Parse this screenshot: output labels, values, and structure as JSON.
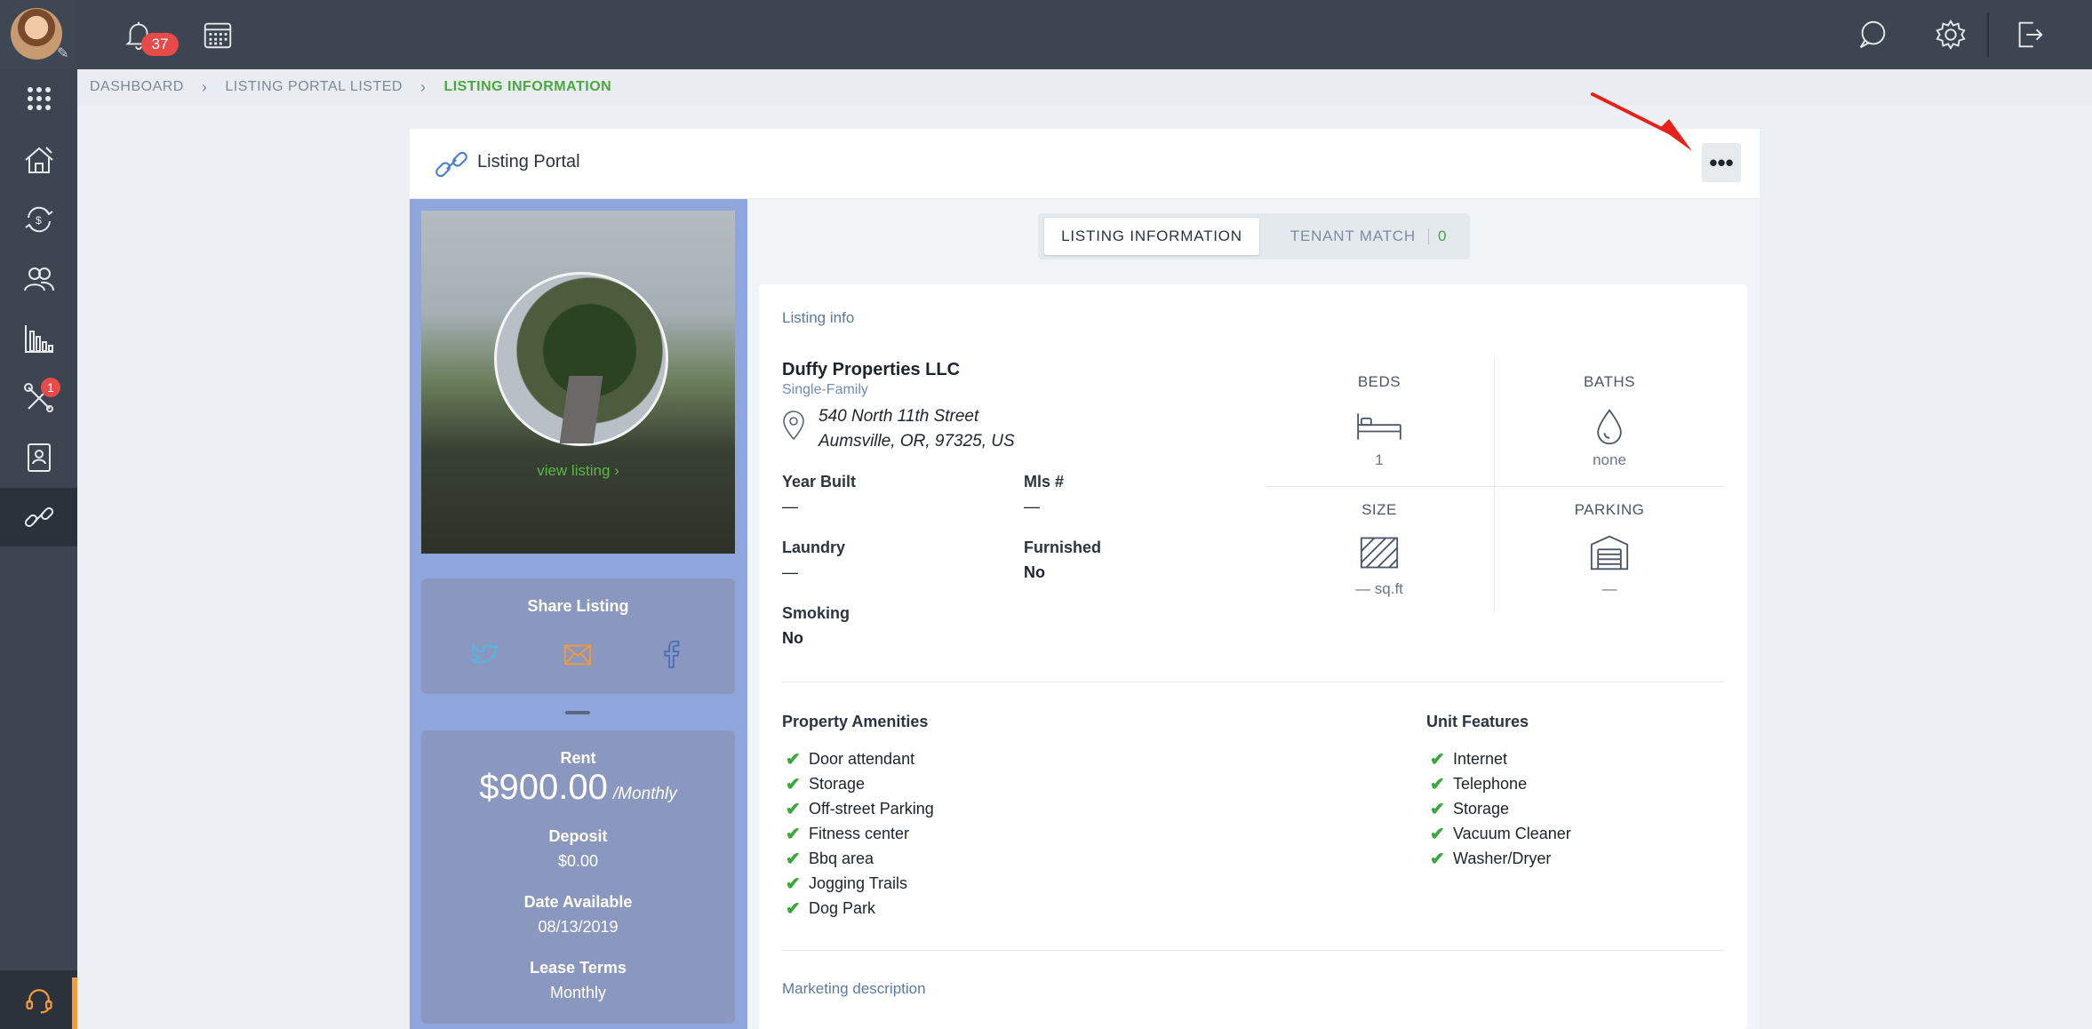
{
  "colors": {
    "sidebar": "#3d4551",
    "accent_green": "#4aa83c",
    "badge_red": "#e84a4a",
    "panel_blue": "#8ea6dc",
    "annotation_arrow": "#e8201a"
  },
  "topbar": {
    "notifications_count": "37"
  },
  "sidebar": {
    "items": [
      {
        "icon": "apps-grid-icon"
      },
      {
        "icon": "properties-icon"
      },
      {
        "icon": "transactions-icon"
      },
      {
        "icon": "people-icon"
      },
      {
        "icon": "reports-icon"
      },
      {
        "icon": "maintenance-icon",
        "badge": "1"
      },
      {
        "icon": "documents-icon"
      },
      {
        "icon": "listing-portal-icon",
        "active": true
      }
    ]
  },
  "breadcrumb": {
    "items": [
      "DASHBOARD",
      "LISTING PORTAL LISTED",
      "LISTING INFORMATION"
    ]
  },
  "card": {
    "title": "Listing Portal",
    "more_label": "•••"
  },
  "left": {
    "view_listing": "view listing ›",
    "share_title": "Share Listing",
    "rent_label": "Rent",
    "rent_amount": "$900.00",
    "rent_period": "/Monthly",
    "deposit_label": "Deposit",
    "deposit_value": "$0.00",
    "date_label": "Date Available",
    "date_value": "08/13/2019",
    "lease_label": "Lease Terms",
    "lease_value": "Monthly"
  },
  "tabs": {
    "info": "LISTING INFORMATION",
    "match": "TENANT MATCH",
    "match_count": "0"
  },
  "listing": {
    "section": "Listing info",
    "owner": "Duffy Properties LLC",
    "type": "Single-Family",
    "address_line1": "540 North 11th Street",
    "address_line2": "Aumsville, OR, 97325, US",
    "year_built_label": "Year Built",
    "year_built_value": "—",
    "mls_label": "Mls #",
    "mls_value": "—",
    "laundry_label": "Laundry",
    "laundry_value": "—",
    "furnished_label": "Furnished",
    "furnished_value": "No",
    "smoking_label": "Smoking",
    "smoking_value": "No"
  },
  "stats": {
    "beds_label": "BEDS",
    "beds_value": "1",
    "baths_label": "BATHS",
    "baths_value": "none",
    "size_label": "SIZE",
    "size_value": "— sq.ft",
    "parking_label": "PARKING",
    "parking_value": "—"
  },
  "amenities": {
    "property_title": "Property Amenities",
    "property": [
      "Door attendant",
      "Storage",
      "Off-street Parking",
      "Fitness center",
      "Bbq area",
      "Jogging Trails",
      "Dog Park"
    ],
    "unit_title": "Unit Features",
    "unit": [
      "Internet",
      "Telephone",
      "Storage",
      "Vacuum Cleaner",
      "Washer/Dryer"
    ]
  },
  "marketing": {
    "section": "Marketing description"
  }
}
